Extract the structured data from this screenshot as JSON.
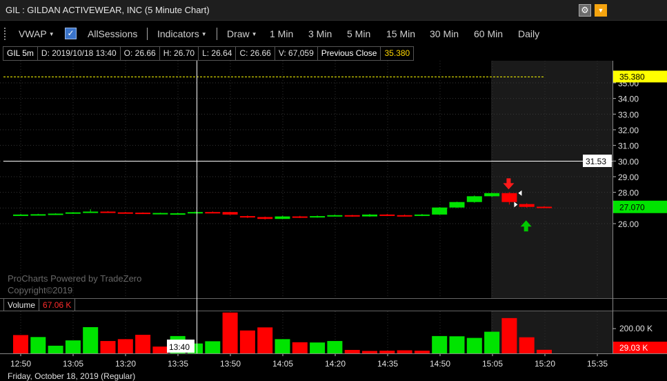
{
  "window": {
    "title": "GIL : GILDAN ACTIVEWEAR, INC (5 Minute Chart)",
    "icons": {
      "settings": "gear-icon",
      "dropdown": "dropdown-icon"
    }
  },
  "toolbar": {
    "vwap": "VWAP",
    "allsessions": "AllSessions",
    "allsessions_checked": true,
    "indicators": "Indicators",
    "draw": "Draw",
    "intervals": [
      "1 Min",
      "3 Min",
      "5 Min",
      "15 Min",
      "30 Min",
      "60 Min",
      "Daily"
    ]
  },
  "info": {
    "symbol": "GIL 5m",
    "date": "D: 2019/10/18 13:40",
    "open": "O: 26.66",
    "high": "H: 26.70",
    "low": "L: 26.64",
    "close": "C: 26.66",
    "volume": "V: 67,059",
    "prev_close_label": "Previous Close",
    "prev_close_value": "35.380"
  },
  "watermark": {
    "line1": "ProCharts Powered by TradeZero",
    "line2": "Copyright©2019"
  },
  "volume_pane": {
    "label": "Volume",
    "value": "67.06 K",
    "axis_tick": "200.00 K",
    "current_label": "29.03 K"
  },
  "footer": {
    "date": "Friday, October 18, 2019 (Regular)"
  },
  "colors": {
    "up": "#00e400",
    "down": "#ff0000",
    "prev_close_line": "#ffff00",
    "crosshair": "#ffffff",
    "session_shade": "#1a1a1a"
  },
  "chart_data": {
    "type": "candlestick",
    "y_ticks": [
      "35.00",
      "34.00",
      "33.00",
      "32.00",
      "31.00",
      "30.00",
      "29.00",
      "28.00",
      "27.00",
      "26.00"
    ],
    "y_range": [
      25.6,
      35.6
    ],
    "x_labels": [
      "12:50",
      "13:05",
      "13:20",
      "13:35",
      "13:50",
      "14:05",
      "14:20",
      "14:35",
      "14:50",
      "15:05",
      "15:20",
      "15:35"
    ],
    "previous_close": 35.38,
    "crosshair_price": "31.53",
    "crosshair_time": "13:40",
    "last_price": "27.070",
    "prev_close_label": "35.380",
    "candles": [
      {
        "t": 0,
        "o": 26.56,
        "h": 26.62,
        "l": 26.52,
        "c": 26.58
      },
      {
        "t": 1,
        "o": 26.58,
        "h": 26.63,
        "l": 26.55,
        "c": 26.6
      },
      {
        "t": 2,
        "o": 26.58,
        "h": 26.66,
        "l": 26.56,
        "c": 26.64
      },
      {
        "t": 3,
        "o": 26.64,
        "h": 26.74,
        "l": 26.62,
        "c": 26.72
      },
      {
        "t": 4,
        "o": 26.72,
        "h": 26.92,
        "l": 26.7,
        "c": 26.77
      },
      {
        "t": 5,
        "o": 26.77,
        "h": 26.8,
        "l": 26.7,
        "c": 26.72
      },
      {
        "t": 6,
        "o": 26.72,
        "h": 26.75,
        "l": 26.66,
        "c": 26.7
      },
      {
        "t": 7,
        "o": 26.7,
        "h": 26.72,
        "l": 26.63,
        "c": 26.66
      },
      {
        "t": 8,
        "o": 26.64,
        "h": 26.7,
        "l": 26.62,
        "c": 26.68
      },
      {
        "t": 9,
        "o": 26.66,
        "h": 26.7,
        "l": 26.64,
        "c": 26.66
      },
      {
        "t": 10,
        "o": 26.66,
        "h": 26.78,
        "l": 26.64,
        "c": 26.74
      },
      {
        "t": 11,
        "o": 26.74,
        "h": 26.78,
        "l": 26.7,
        "c": 26.72
      },
      {
        "t": 12,
        "o": 26.74,
        "h": 26.76,
        "l": 26.55,
        "c": 26.58
      },
      {
        "t": 13,
        "o": 26.48,
        "h": 26.52,
        "l": 26.36,
        "c": 26.42
      },
      {
        "t": 14,
        "o": 26.42,
        "h": 26.45,
        "l": 26.26,
        "c": 26.3
      },
      {
        "t": 15,
        "o": 26.3,
        "h": 26.5,
        "l": 26.28,
        "c": 26.46
      },
      {
        "t": 16,
        "o": 26.46,
        "h": 26.5,
        "l": 26.36,
        "c": 26.4
      },
      {
        "t": 17,
        "o": 26.4,
        "h": 26.52,
        "l": 26.38,
        "c": 26.48
      },
      {
        "t": 18,
        "o": 26.48,
        "h": 26.58,
        "l": 26.46,
        "c": 26.54
      },
      {
        "t": 19,
        "o": 26.54,
        "h": 26.56,
        "l": 26.44,
        "c": 26.48
      },
      {
        "t": 20,
        "o": 26.46,
        "h": 26.62,
        "l": 26.44,
        "c": 26.58
      },
      {
        "t": 21,
        "o": 26.58,
        "h": 26.62,
        "l": 26.48,
        "c": 26.54
      },
      {
        "t": 22,
        "o": 26.54,
        "h": 26.58,
        "l": 26.46,
        "c": 26.5
      },
      {
        "t": 23,
        "o": 26.5,
        "h": 26.62,
        "l": 26.48,
        "c": 26.58
      },
      {
        "t": 24,
        "o": 26.58,
        "h": 27.05,
        "l": 26.56,
        "c": 27.03
      },
      {
        "t": 25,
        "o": 27.03,
        "h": 27.4,
        "l": 27.0,
        "c": 27.38
      },
      {
        "t": 26,
        "o": 27.38,
        "h": 27.8,
        "l": 27.34,
        "c": 27.75
      },
      {
        "t": 27,
        "o": 27.75,
        "h": 27.98,
        "l": 27.7,
        "c": 27.95
      },
      {
        "t": 28,
        "o": 27.95,
        "h": 28.02,
        "l": 27.22,
        "c": 27.38
      },
      {
        "t": 29,
        "o": 27.25,
        "h": 27.3,
        "l": 27.02,
        "c": 27.07
      },
      {
        "t": 30,
        "o": 27.08,
        "h": 27.12,
        "l": 27.04,
        "c": 27.07
      }
    ],
    "volume_ticks": [
      "200.00 K"
    ],
    "volume_range": [
      0,
      340
    ],
    "volume": [
      {
        "t": 0,
        "v": 148,
        "up": false
      },
      {
        "t": 1,
        "v": 132,
        "up": true
      },
      {
        "t": 2,
        "v": 62,
        "up": true
      },
      {
        "t": 3,
        "v": 105,
        "up": true
      },
      {
        "t": 4,
        "v": 212,
        "up": true
      },
      {
        "t": 5,
        "v": 100,
        "up": false
      },
      {
        "t": 6,
        "v": 115,
        "up": false
      },
      {
        "t": 7,
        "v": 150,
        "up": false
      },
      {
        "t": 8,
        "v": 55,
        "up": false
      },
      {
        "t": 9,
        "v": 140,
        "up": true
      },
      {
        "t": 10,
        "v": 80,
        "up": true
      },
      {
        "t": 11,
        "v": 98,
        "up": true
      },
      {
        "t": 12,
        "v": 330,
        "up": false
      },
      {
        "t": 13,
        "v": 185,
        "up": false
      },
      {
        "t": 14,
        "v": 210,
        "up": false
      },
      {
        "t": 15,
        "v": 115,
        "up": true
      },
      {
        "t": 16,
        "v": 90,
        "up": false
      },
      {
        "t": 17,
        "v": 88,
        "up": true
      },
      {
        "t": 18,
        "v": 100,
        "up": true
      },
      {
        "t": 19,
        "v": 28,
        "up": false
      },
      {
        "t": 20,
        "v": 20,
        "up": false
      },
      {
        "t": 21,
        "v": 22,
        "up": false
      },
      {
        "t": 22,
        "v": 25,
        "up": false
      },
      {
        "t": 23,
        "v": 22,
        "up": false
      },
      {
        "t": 24,
        "v": 140,
        "up": true
      },
      {
        "t": 25,
        "v": 138,
        "up": true
      },
      {
        "t": 26,
        "v": 125,
        "up": true
      },
      {
        "t": 27,
        "v": 175,
        "up": true
      },
      {
        "t": 28,
        "v": 285,
        "up": false
      },
      {
        "t": 29,
        "v": 130,
        "up": false
      },
      {
        "t": 30,
        "v": 29,
        "up": false
      }
    ],
    "signals": [
      {
        "t": 28,
        "type": "sell",
        "price": 28.5
      },
      {
        "t": 29,
        "type": "buy",
        "price": 25.9
      }
    ]
  }
}
